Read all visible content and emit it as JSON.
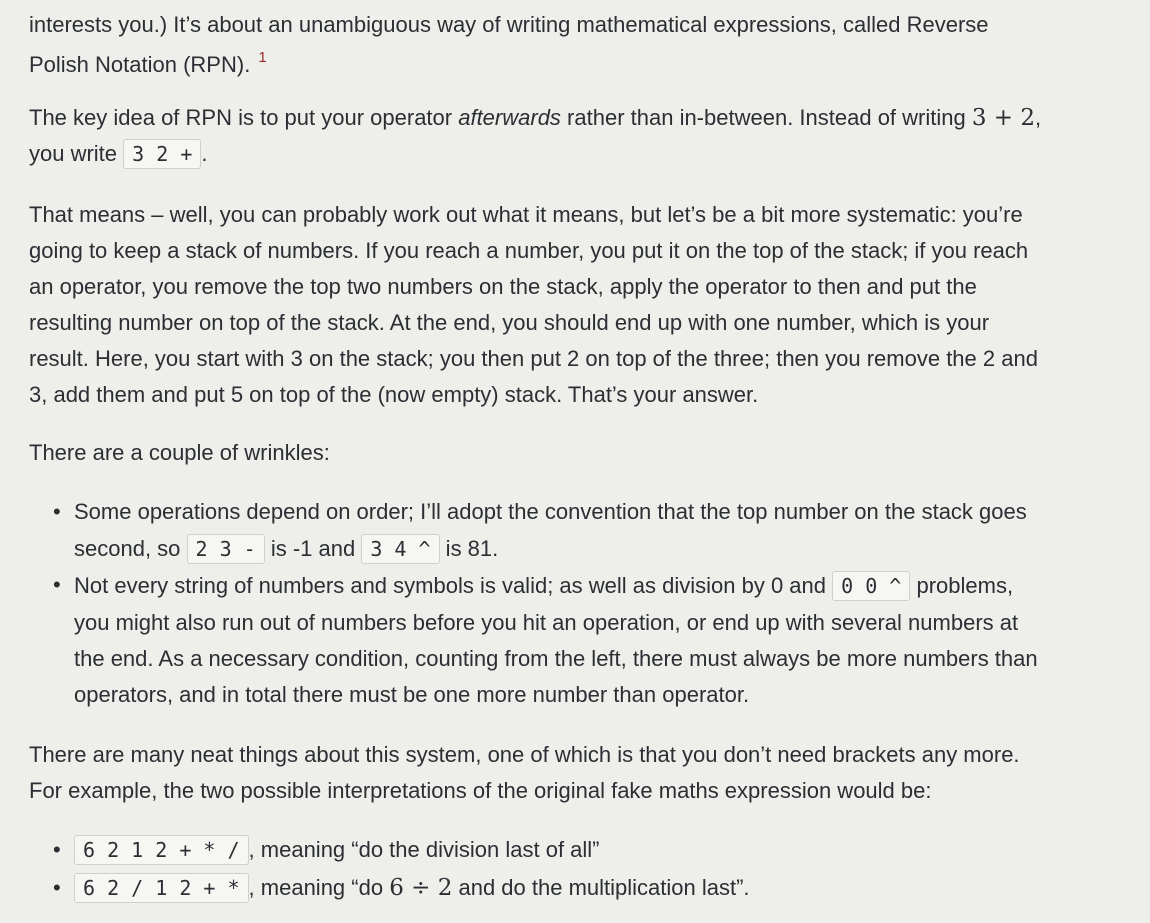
{
  "intro": {
    "line1": "interests you.) It’s about an unambiguous way of writing mathematical expressions, called Reverse",
    "line2": "Polish Notation (RPN).",
    "footnote_marker": "1"
  },
  "key_idea": {
    "text_a": "The key idea of RPN is to put your operator ",
    "emph": "afterwards",
    "text_b": " rather than in-between. Instead of writing ",
    "math": "3 + 2",
    "text_c": ",",
    "line2_a": "you write ",
    "code": "3 2 +",
    "line2_b": "."
  },
  "explanation": {
    "lines": [
      "That means – well, you can probably work out what it means, but let’s be a bit more systematic: you’re",
      "going to keep a stack of numbers. If you reach a number, you put it on the top of the stack; if you reach",
      "an operator, you remove the top two numbers on the stack, apply the operator to then and put the",
      "resulting number on top of the stack. At the end, you should end up with one number, which is your",
      "result. Here, you start with 3 on the stack; you then put 2 on top of the three; then you remove the 2 and",
      "3, add them and put 5 on top of the (now empty) stack. That’s your answer."
    ]
  },
  "wrinkles_intro": "There are a couple of wrinkles:",
  "wrinkles": {
    "item1": {
      "line1": "Some operations depend on order; I’ll adopt the convention that the top number on the stack goes",
      "line2_a": "second, so ",
      "code1": "2 3 -",
      "line2_b": " is -1 and ",
      "code2": "3 4 ^",
      "line2_c": " is 81."
    },
    "item2": {
      "line1_a": "Not every string of numbers and symbols is valid; as well as division by 0 and ",
      "code1": "0 0 ^",
      "line1_b": " problems,",
      "line2": "you might also run out of numbers before you hit an operation, or end up with several numbers at",
      "line3": "the end. As a necessary condition, counting from the left, there must always be more numbers than",
      "line4": "operators, and in total there must be one more number than operator."
    }
  },
  "brackets": {
    "line1": "There are many neat things about this system, one of which is that you don’t need brackets any more.",
    "line2": "For example, the two possible interpretations of the original fake maths expression would be:"
  },
  "interpretations": {
    "item1": {
      "code": "6 2 1 2 + * /",
      "text": ", meaning “do the division last of all”"
    },
    "item2": {
      "code": "6 2 / 1 2 + *",
      "text_a": ", meaning “do ",
      "math": "6 ÷ 2",
      "text_b": " and do the multiplication last”."
    }
  },
  "bullet_glyph": "•"
}
